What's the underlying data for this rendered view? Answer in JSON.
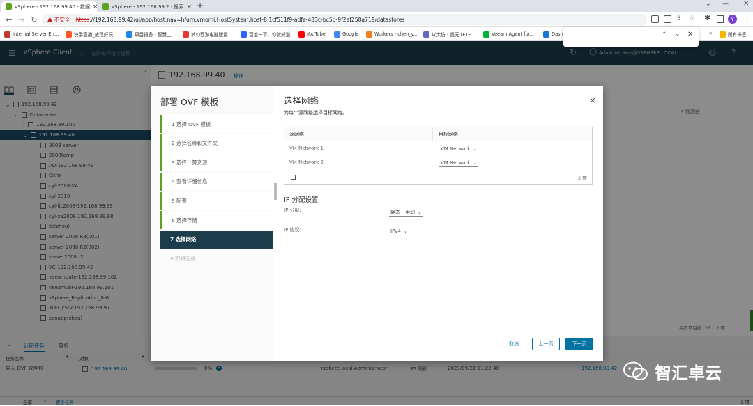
{
  "browser": {
    "tabs": [
      {
        "title": "vSphere - 192.168.99.40 - 数据"
      },
      {
        "title": "vSphere - 192.168.99.2 - 搜索"
      }
    ],
    "new_tab": "+",
    "security_warning": "不安全",
    "url_scheme": "https",
    "url_rest": "://192.168.99.42/ui/app/host;nav=h/urn:vmomi:HostSystem:host-8:1cf511f9-adfe-483c-bc5d-9f2ef258a719/datastores",
    "profile_initial": "Y",
    "bookmarks": [
      {
        "label": "Internal Server Err...",
        "color": "#c0392b"
      },
      {
        "label": "快手直播_放现好玩...",
        "color": "#ff5722"
      },
      {
        "label": "项目报备 - 智慧工...",
        "color": "#1e88e5"
      },
      {
        "label": "梦幻西游电脑版置...",
        "color": "#e53935"
      },
      {
        "label": "百度一下，你就知道",
        "color": "#2962ff"
      },
      {
        "label": "YouTube",
        "color": "#ff0000"
      },
      {
        "label": "Google",
        "color": "#4285f4"
      },
      {
        "label": "Workers - chen_y...",
        "color": "#f38020"
      },
      {
        "label": "以太坊 - 奥元 (ETH...",
        "color": "#5c6bc0"
      },
      {
        "label": "Veeam Agent for...",
        "color": "#00b336"
      },
      {
        "label": "Dashb",
        "color": "#1976d2"
      }
    ],
    "bookmarks_more": "»",
    "all_bookmarks": "所有书签"
  },
  "vsphere": {
    "app_name": "vSphere Client",
    "search_placeholder": "在所有环境中搜索",
    "user": "Administrator@VSPHERE.LOCAL",
    "host_title": "192.168.99.40",
    "actions_label": "操作",
    "filter_placeholder": "筛选器",
    "page_size_label": "每页项目数",
    "page_size": "35",
    "item_count": "2 项",
    "tree": [
      {
        "label": "192.168.99.42",
        "level": 0,
        "type": "vc"
      },
      {
        "label": "Datacenter",
        "level": 1,
        "type": "dc"
      },
      {
        "label": "192.168.99.100",
        "level": 2,
        "type": "host"
      },
      {
        "label": "192.168.99.40",
        "level": 2,
        "type": "host",
        "selected": true
      },
      {
        "label": "2008 server",
        "level": 3,
        "type": "vm"
      },
      {
        "label": "2008temp",
        "level": 3,
        "type": "vm"
      },
      {
        "label": "AD-192.168.99.41",
        "level": 3,
        "type": "vm"
      },
      {
        "label": "Citrix",
        "level": 3,
        "type": "vm"
      },
      {
        "label": "cyl-2008-XA",
        "level": 3,
        "type": "vm"
      },
      {
        "label": "cyl-2019",
        "level": 3,
        "type": "vm"
      },
      {
        "label": "cyl-lic2008-192.168.99.99",
        "level": 3,
        "type": "vm"
      },
      {
        "label": "cyl-xa2008-192.168.99.98",
        "level": 3,
        "type": "vm"
      },
      {
        "label": "lic(zhou)",
        "level": 3,
        "type": "vm"
      },
      {
        "label": "server 2008 R2(001)",
        "level": 3,
        "type": "vm"
      },
      {
        "label": "server 2008 R2(002)",
        "level": 3,
        "type": "vm"
      },
      {
        "label": "server2008 r2",
        "level": 3,
        "type": "vm"
      },
      {
        "label": "VC-192.168.99.42",
        "level": 3,
        "type": "vm"
      },
      {
        "label": "veeamdate-192.168.99.102",
        "level": 3,
        "type": "vm"
      },
      {
        "label": "veeamvbr-192.168.99.101",
        "level": 3,
        "type": "vm"
      },
      {
        "label": "vSphere_Replication_8-6",
        "level": 3,
        "type": "vm"
      },
      {
        "label": "XD-LicSrv-192.168.99.97",
        "level": 3,
        "type": "vm"
      },
      {
        "label": "xenapp(zhou)",
        "level": 3,
        "type": "vm"
      }
    ],
    "tasks": {
      "tab_recent": "近期任务",
      "tab_alarms": "警报",
      "col_name": "任务名称",
      "col_target": "对象",
      "row": {
        "name": "导入 OVF 软件包",
        "target": "192.168.99.40",
        "progress_text": "0%",
        "progress": 0,
        "initiator": "vsphere.local\\Administrator",
        "queued": "85 毫秒",
        "start": "2023/09/22 11:22:40",
        "server": "192.168.99.42"
      },
      "filter_all": "全部",
      "more_tasks": "更多任务",
      "count": "1 项"
    }
  },
  "dialog": {
    "wizard_title": "部署 OVF 模板",
    "steps": [
      {
        "label": "1  选择 OVF 模板",
        "state": "done"
      },
      {
        "label": "2  选择名称和文件夹",
        "state": "done"
      },
      {
        "label": "3  选择计算资源",
        "state": "done"
      },
      {
        "label": "4  查看详细信息",
        "state": "done"
      },
      {
        "label": "5  配置",
        "state": "done"
      },
      {
        "label": "6  选择存储",
        "state": "done"
      },
      {
        "label": "7  选择网络",
        "state": "current"
      },
      {
        "label": "8  即将完成",
        "state": "disabled"
      }
    ],
    "page_title": "选择网络",
    "page_subtitle": "为每个源网络选择目标网络。",
    "table": {
      "col_source": "源网络",
      "col_dest": "目标网络",
      "rows": [
        {
          "source": "VM Network 1",
          "dest": "VM Network"
        },
        {
          "source": "VM Network 2",
          "dest": "VM Network"
        }
      ],
      "footer_count": "2 项"
    },
    "ip_section": "IP 分配设置",
    "ip_alloc_label": "IP 分配:",
    "ip_alloc_value": "静态 - 手动",
    "ip_proto_label": "IP 协议:",
    "ip_proto_value": "IPv4",
    "cancel": "取消",
    "back": "上一页",
    "next": "下一页"
  },
  "watermark": {
    "text": "智汇卓云"
  }
}
